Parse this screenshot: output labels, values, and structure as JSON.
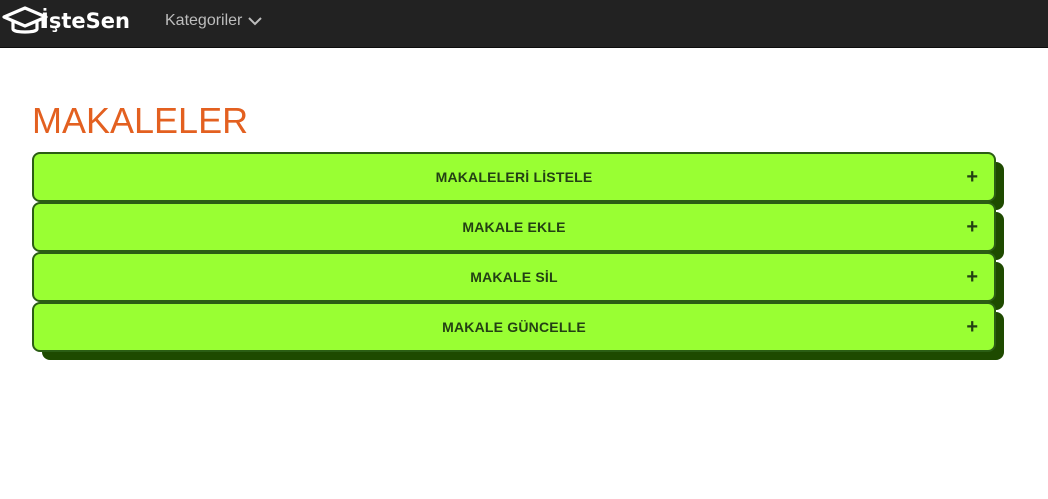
{
  "navbar": {
    "brand": "İşteSen",
    "brand_icon": "graduation-cap-icon",
    "categories_label": "Kategoriler",
    "categories_icon": "chevron-down-icon"
  },
  "page": {
    "title": "MAKALELER"
  },
  "accordion": {
    "items": [
      {
        "label": "MAKALELERİ LİSTELE",
        "toggle": "+"
      },
      {
        "label": "MAKALE EKLE",
        "toggle": "+"
      },
      {
        "label": "MAKALE SİL",
        "toggle": "+"
      },
      {
        "label": "MAKALE GÜNCELLE",
        "toggle": "+"
      }
    ]
  },
  "colors": {
    "navbar_bg": "#222222",
    "title": "#e36020",
    "accordion_bg": "#99ff33",
    "accordion_border": "#2b5e14",
    "accordion_shadow": "#1e4a00",
    "accordion_text": "#234014"
  }
}
